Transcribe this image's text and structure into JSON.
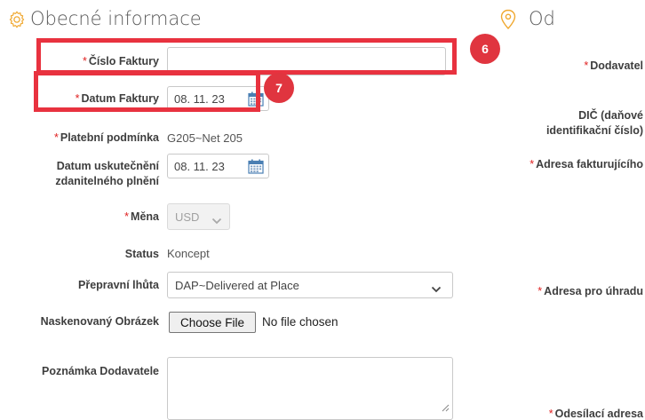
{
  "sections": {
    "general_title": "Obecné informace",
    "from_title": "Od"
  },
  "fields": {
    "invoice_number": {
      "label": "Číslo Faktury",
      "required": "*",
      "value": ""
    },
    "invoice_date": {
      "label": "Datum Faktury",
      "required": "*",
      "value": "08. 11. 23"
    },
    "payment_terms": {
      "label": "Platební podmínka",
      "required": "*",
      "value": "G205~Net 205"
    },
    "tax_date": {
      "label_line1": "Datum uskutečnění",
      "label_line2": "zdanitelného plnění",
      "value": "08. 11. 23"
    },
    "currency": {
      "label": "Měna",
      "required": "*",
      "value": "USD"
    },
    "status": {
      "label": "Status",
      "value": "Koncept"
    },
    "shipping_term": {
      "label": "Přepravní lhůta",
      "value": "DAP~Delivered at Place"
    },
    "scanned_image": {
      "label": "Naskenovaný Obrázek",
      "button": "Choose File",
      "note": "No file chosen"
    },
    "supplier_note": {
      "label": "Poznámka Dodavatele",
      "value": ""
    }
  },
  "from": {
    "supplier": {
      "label": "Dodavatel",
      "required": "*"
    },
    "tax_id": {
      "label_line1": "DIČ (daňové",
      "label_line2": "identifikační číslo)"
    },
    "billing_address": {
      "label": "Adresa fakturujícího",
      "required": "*"
    },
    "remit_address": {
      "label": "Adresa pro úhradu",
      "required": "*"
    },
    "ship_from_address": {
      "label": "Odesílací adresa",
      "required": "*"
    }
  },
  "annotations": {
    "badge_6": "6",
    "badge_7": "7"
  },
  "icons": {
    "general_header": "gear-icon",
    "from_header": "location-pin-icon",
    "date_picker": "calendar-icon",
    "dropdown": "chevron-down-icon"
  },
  "colors": {
    "annotation_red": "#e8323f",
    "required_asterisk": "#e02020",
    "header_icon": "#f0a830"
  }
}
